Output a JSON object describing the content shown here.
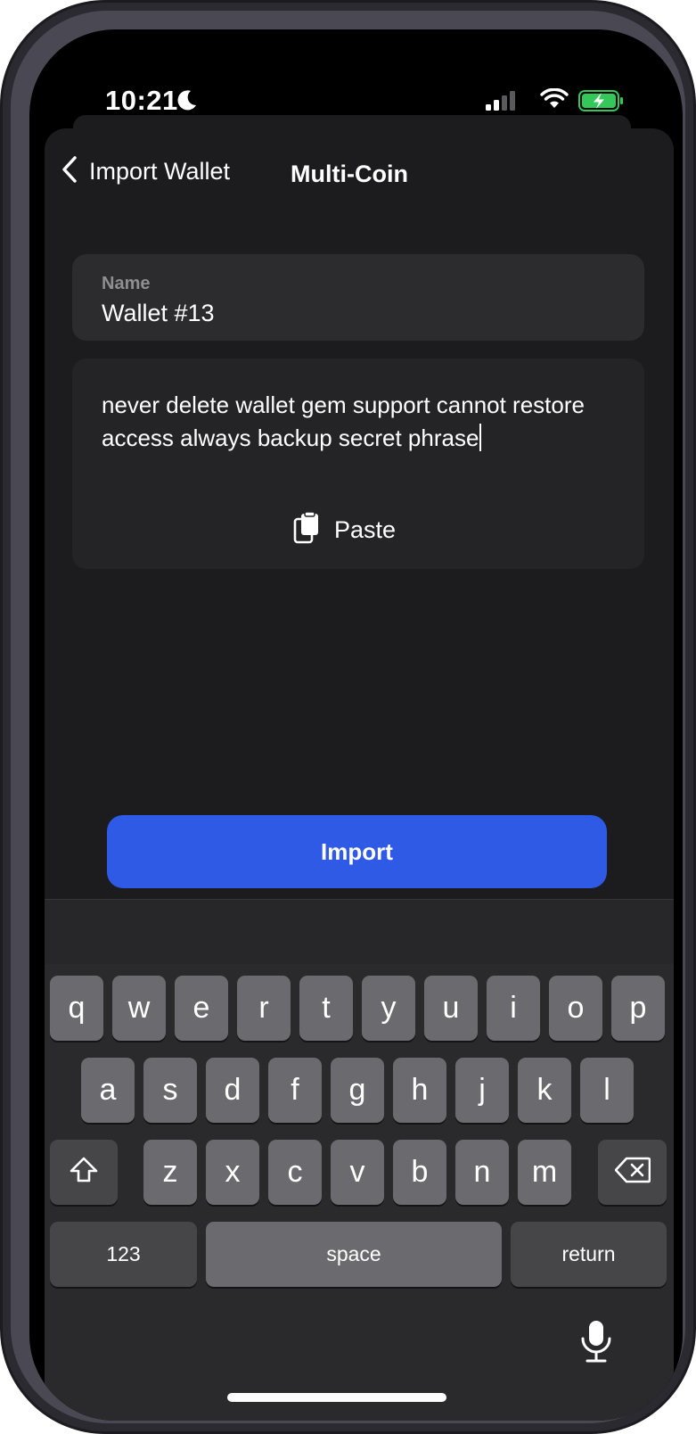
{
  "status_bar": {
    "time": "10:21",
    "moon_icon": "moon-icon",
    "signal_icon": "cellular-signal-icon",
    "wifi_icon": "wifi-icon",
    "battery_icon": "battery-charging-icon",
    "battery_color": "#34c759"
  },
  "nav": {
    "back_label": "Import Wallet",
    "title": "Multi-Coin"
  },
  "name_field": {
    "label": "Name",
    "value": "Wallet #13"
  },
  "phrase_field": {
    "value": "never delete wallet gem support cannot restore access always backup secret phrase"
  },
  "paste_button": {
    "label": "Paste",
    "icon": "clipboard-icon"
  },
  "import_button": {
    "label": "Import",
    "color": "#2e5ae6"
  },
  "keyboard": {
    "row1": [
      "q",
      "w",
      "e",
      "r",
      "t",
      "y",
      "u",
      "i",
      "o",
      "p"
    ],
    "row2": [
      "a",
      "s",
      "d",
      "f",
      "g",
      "h",
      "j",
      "k",
      "l"
    ],
    "row3": [
      "z",
      "x",
      "c",
      "v",
      "b",
      "n",
      "m"
    ],
    "numbers_label": "123",
    "space_label": "space",
    "return_label": "return",
    "shift_icon": "shift-icon",
    "delete_icon": "backspace-icon",
    "mic_icon": "microphone-icon"
  }
}
